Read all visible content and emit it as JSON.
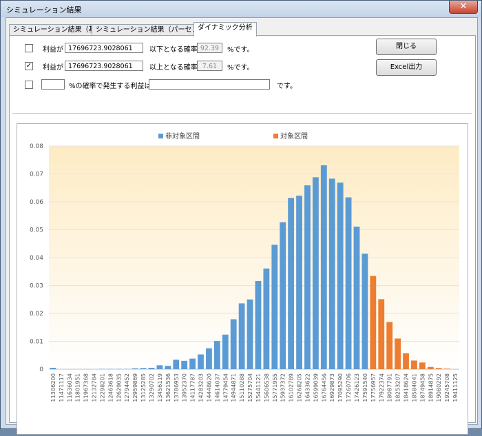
{
  "window": {
    "title": "シミュレーション結果",
    "close_label": "✕"
  },
  "tabs": [
    {
      "label": "シミュレーション結果（基本）",
      "active": false
    },
    {
      "label": "シミュレーション結果（パーセンタイル）",
      "active": false
    },
    {
      "label": "ダイナミック分析",
      "active": true
    }
  ],
  "controls": {
    "row1": {
      "checked": false,
      "label": "利益が",
      "value": "17696723.9028061",
      "mid_label": "以下となる確率は",
      "prob": "92.39",
      "suffix": "%です。"
    },
    "row2": {
      "checked": true,
      "label": "利益が",
      "value": "17696723.9028061",
      "mid_label": "以上となる確率は",
      "prob": "7.61",
      "suffix": "%です。"
    },
    "row3": {
      "checked": false,
      "percent_value": "",
      "mid_label": "%の確率で発生する利益は",
      "result_value": "",
      "suffix": "です。"
    },
    "check_mark": "✓"
  },
  "buttons": {
    "close_label": "閉じる",
    "excel_label": "Excel出力"
  },
  "chart_data": {
    "type": "bar",
    "title": "",
    "xlabel": "",
    "ylabel": "",
    "ylim": [
      0,
      0.08
    ],
    "yticks": [
      0,
      0.01,
      0.02,
      0.03,
      0.04,
      0.05,
      0.06,
      0.07,
      0.08
    ],
    "ytick_labels": [
      "0",
      "0.01",
      "0.02",
      "0.03",
      "0.04",
      "0.05",
      "0.06",
      "0.07",
      "0.08"
    ],
    "grid": true,
    "legend_position": "top-center",
    "colors": {
      "non_target": "#5b9bd5",
      "target": "#ed7d31",
      "band_top": "#fdebc4",
      "band_bottom": "#ffffff"
    },
    "categories": [
      "11306200",
      "11471117",
      "11636034",
      "11801951",
      "11967368",
      "12132784",
      "12298201",
      "12463618",
      "12629035",
      "12794452",
      "12959869",
      "13125285",
      "13290702",
      "13456119",
      "13621536",
      "13786953",
      "13952370",
      "14117787",
      "14283203",
      "14448620",
      "14614037",
      "14779454",
      "14944871",
      "15110288",
      "15275704",
      "15441121",
      "15606538",
      "15771955",
      "15937372",
      "16102789",
      "16268205",
      "16433622",
      "16599039",
      "16764456",
      "16929873",
      "17095290",
      "17260706",
      "17426123",
      "17591540",
      "17756957",
      "17922374",
      "18087791",
      "18253207",
      "18418624",
      "18584041",
      "18749458",
      "18914875",
      "19080292",
      "19245708",
      "19411125"
    ],
    "series": [
      {
        "name": "非対象区間",
        "values": [
          0.0005,
          0,
          0,
          0,
          0,
          0,
          0.0001,
          0.0001,
          0.0001,
          0.0001,
          0.0003,
          0.0004,
          0.0005,
          0.0014,
          0.0012,
          0.0034,
          0.003,
          0.0038,
          0.0053,
          0.0075,
          0.0101,
          0.0124,
          0.0179,
          0.0236,
          0.025,
          0.0316,
          0.0361,
          0.0446,
          0.0527,
          0.0614,
          0.0622,
          0.0659,
          0.0688,
          0.0731,
          0.0683,
          0.0669,
          0.0616,
          0.0511,
          0.0414,
          0,
          0,
          0,
          0,
          0,
          0,
          0,
          0,
          0,
          0,
          0
        ]
      },
      {
        "name": "対象区間",
        "values": [
          0,
          0,
          0,
          0,
          0,
          0,
          0,
          0,
          0,
          0,
          0,
          0,
          0,
          0,
          0,
          0,
          0,
          0,
          0,
          0,
          0,
          0,
          0,
          0,
          0,
          0,
          0,
          0,
          0,
          0,
          0,
          0,
          0,
          0,
          0,
          0,
          0,
          0,
          0,
          0.0334,
          0.0251,
          0.0169,
          0.011,
          0.0057,
          0.0031,
          0.0024,
          0.0008,
          0.0004,
          0.0002,
          0
        ]
      }
    ]
  }
}
